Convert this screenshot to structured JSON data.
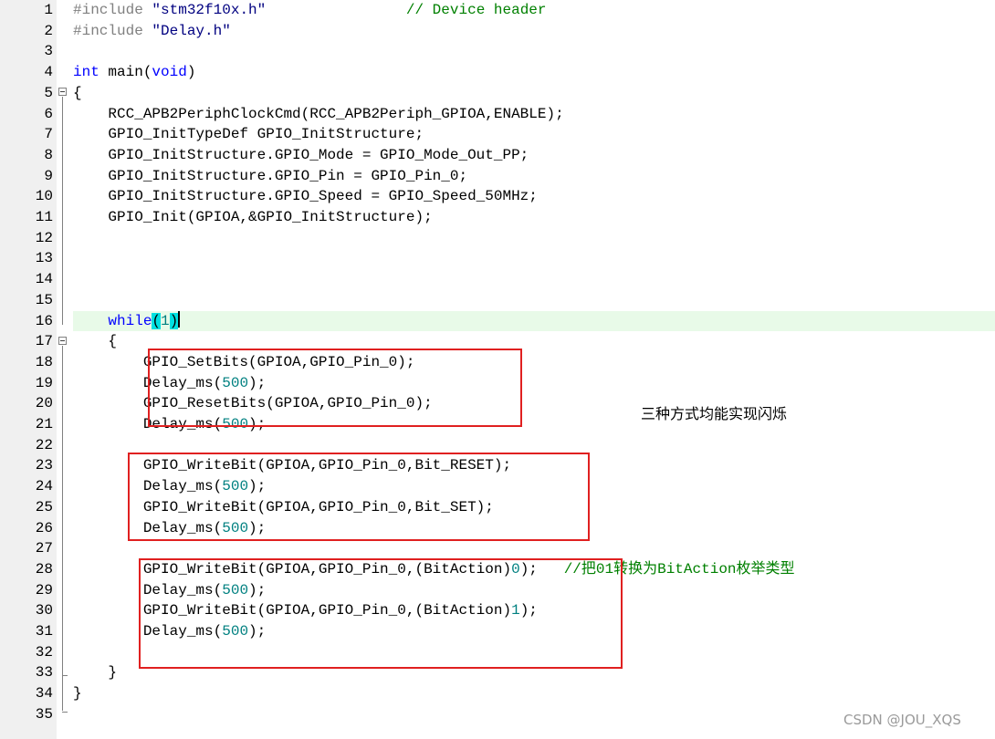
{
  "editor": {
    "lines": [
      {
        "n": "1",
        "tokens": [
          {
            "t": "#include ",
            "c": "pre"
          },
          {
            "t": "\"stm32f10x.h\"",
            "c": "str"
          },
          {
            "t": "                // Device header",
            "c": "cmt"
          }
        ]
      },
      {
        "n": "2",
        "tokens": [
          {
            "t": "#include ",
            "c": "pre"
          },
          {
            "t": "\"Delay.h\"",
            "c": "str"
          }
        ]
      },
      {
        "n": "3",
        "tokens": []
      },
      {
        "n": "4",
        "tokens": [
          {
            "t": "int",
            "c": "kw"
          },
          {
            "t": " main(",
            "c": "plain"
          },
          {
            "t": "void",
            "c": "kw"
          },
          {
            "t": ")",
            "c": "plain"
          }
        ]
      },
      {
        "n": "5",
        "tokens": [
          {
            "t": "{",
            "c": "plain"
          }
        ]
      },
      {
        "n": "6",
        "tokens": [
          {
            "t": "    RCC_APB2PeriphClockCmd(RCC_APB2Periph_GPIOA,ENABLE);",
            "c": "plain"
          }
        ]
      },
      {
        "n": "7",
        "tokens": [
          {
            "t": "    GPIO_InitTypeDef GPIO_InitStructure;",
            "c": "plain"
          }
        ]
      },
      {
        "n": "8",
        "tokens": [
          {
            "t": "    GPIO_InitStructure.GPIO_Mode = GPIO_Mode_Out_PP;",
            "c": "plain"
          }
        ]
      },
      {
        "n": "9",
        "tokens": [
          {
            "t": "    GPIO_InitStructure.GPIO_Pin = GPIO_Pin_0;",
            "c": "plain"
          }
        ]
      },
      {
        "n": "10",
        "tokens": [
          {
            "t": "    GPIO_InitStructure.GPIO_Speed = GPIO_Speed_50MHz;",
            "c": "plain"
          }
        ]
      },
      {
        "n": "11",
        "tokens": [
          {
            "t": "    GPIO_Init(GPIOA,&GPIO_InitStructure);",
            "c": "plain"
          }
        ]
      },
      {
        "n": "12",
        "tokens": []
      },
      {
        "n": "13",
        "tokens": []
      },
      {
        "n": "14",
        "tokens": []
      },
      {
        "n": "15",
        "tokens": []
      },
      {
        "n": "16",
        "current": true,
        "tokens": [
          {
            "t": "    ",
            "c": "plain"
          },
          {
            "t": "while",
            "c": "kw"
          },
          {
            "t": "(",
            "c": "match"
          },
          {
            "t": "1",
            "c": "num"
          },
          {
            "t": ")",
            "c": "match"
          }
        ]
      },
      {
        "n": "17",
        "tokens": [
          {
            "t": "    {",
            "c": "plain"
          }
        ]
      },
      {
        "n": "18",
        "tokens": [
          {
            "t": "        GPIO_SetBits(GPIOA,GPIO_Pin_0);",
            "c": "plain"
          }
        ]
      },
      {
        "n": "19",
        "tokens": [
          {
            "t": "        Delay_ms(",
            "c": "plain"
          },
          {
            "t": "500",
            "c": "num"
          },
          {
            "t": ");",
            "c": "plain"
          }
        ]
      },
      {
        "n": "20",
        "tokens": [
          {
            "t": "        GPIO_ResetBits(GPIOA,GPIO_Pin_0);",
            "c": "plain"
          }
        ]
      },
      {
        "n": "21",
        "tokens": [
          {
            "t": "        Delay_ms(",
            "c": "plain"
          },
          {
            "t": "500",
            "c": "num"
          },
          {
            "t": ");",
            "c": "plain"
          }
        ]
      },
      {
        "n": "22",
        "tokens": []
      },
      {
        "n": "23",
        "tokens": [
          {
            "t": "        GPIO_WriteBit(GPIOA,GPIO_Pin_0,Bit_RESET);",
            "c": "plain"
          }
        ]
      },
      {
        "n": "24",
        "tokens": [
          {
            "t": "        Delay_ms(",
            "c": "plain"
          },
          {
            "t": "500",
            "c": "num"
          },
          {
            "t": ");",
            "c": "plain"
          }
        ]
      },
      {
        "n": "25",
        "tokens": [
          {
            "t": "        GPIO_WriteBit(GPIOA,GPIO_Pin_0,Bit_SET);",
            "c": "plain"
          }
        ]
      },
      {
        "n": "26",
        "tokens": [
          {
            "t": "        Delay_ms(",
            "c": "plain"
          },
          {
            "t": "500",
            "c": "num"
          },
          {
            "t": ");",
            "c": "plain"
          }
        ]
      },
      {
        "n": "27",
        "tokens": []
      },
      {
        "n": "28",
        "tokens": [
          {
            "t": "        GPIO_WriteBit(GPIOA,GPIO_Pin_0,(BitAction)",
            "c": "plain"
          },
          {
            "t": "0",
            "c": "num"
          },
          {
            "t": ");",
            "c": "plain"
          },
          {
            "t": "   //把01转换为BitAction枚举类型",
            "c": "cmt"
          }
        ]
      },
      {
        "n": "29",
        "tokens": [
          {
            "t": "        Delay_ms(",
            "c": "plain"
          },
          {
            "t": "500",
            "c": "num"
          },
          {
            "t": ");",
            "c": "plain"
          }
        ]
      },
      {
        "n": "30",
        "tokens": [
          {
            "t": "        GPIO_WriteBit(GPIOA,GPIO_Pin_0,(BitAction)",
            "c": "plain"
          },
          {
            "t": "1",
            "c": "num"
          },
          {
            "t": ");",
            "c": "plain"
          }
        ]
      },
      {
        "n": "31",
        "tokens": [
          {
            "t": "        Delay_ms(",
            "c": "plain"
          },
          {
            "t": "500",
            "c": "num"
          },
          {
            "t": ");",
            "c": "plain"
          }
        ]
      },
      {
        "n": "32",
        "tokens": []
      },
      {
        "n": "33",
        "tokens": [
          {
            "t": "    }",
            "c": "plain"
          }
        ]
      },
      {
        "n": "34",
        "tokens": [
          {
            "t": "}",
            "c": "plain"
          }
        ]
      },
      {
        "n": "35",
        "tokens": []
      }
    ]
  },
  "annotation": {
    "note": "三种方式均能实现闪烁"
  },
  "watermark": "CSDN @JOU_XQS",
  "colors": {
    "box_border": "#e02020",
    "current_line": "#e8fae8",
    "bracket_match": "#00e0e0",
    "comment": "#008000",
    "keyword": "#0000ff",
    "number": "#008080",
    "string": "#000080",
    "preprocessor": "#808080"
  }
}
